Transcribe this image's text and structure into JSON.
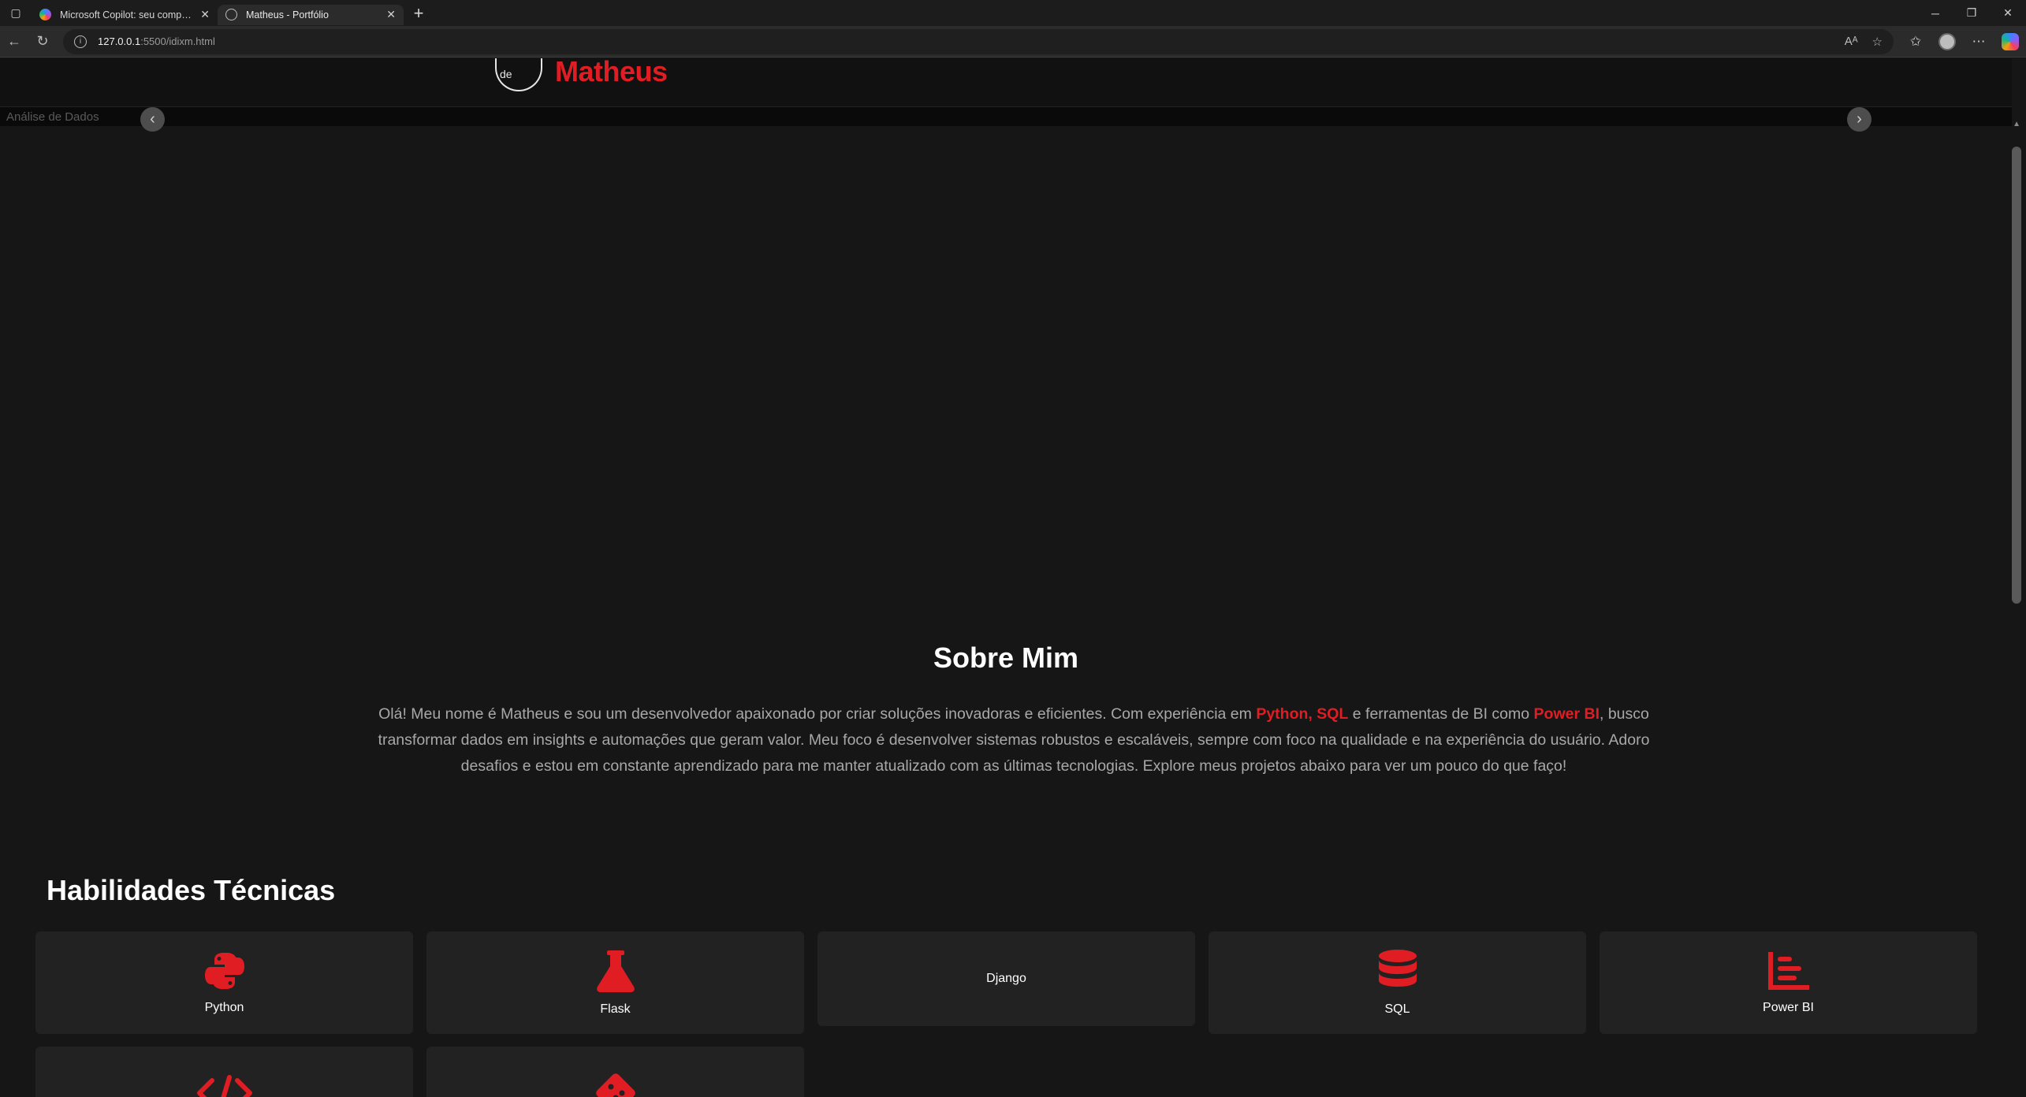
{
  "browser": {
    "tabs": [
      {
        "title": "Microsoft Copilot: seu companheiro",
        "active": false
      },
      {
        "title": "Matheus - Portfólio",
        "active": true
      }
    ],
    "url_host": "127.0.0.1",
    "url_path": ":5500/idixm.html"
  },
  "header": {
    "logo_text": "de",
    "brand": "Matheus"
  },
  "carousel": {
    "alt_text": "Análise de Dados"
  },
  "about": {
    "title": "Sobre Mim",
    "p1": "Olá! Meu nome é Matheus e sou um desenvolvedor apaixonado por criar soluções inovadoras e eficientes. Com experiência em ",
    "hl1": "Python",
    "sep1": ", ",
    "hl2": "SQL",
    "p2": " e ferramentas de BI como ",
    "hl3": "Power BI",
    "p3": ", busco transformar dados em insights e automações que geram valor. Meu foco é desenvolver sistemas robustos e escaláveis, sempre com foco na qualidade e na experiência do usuário. Adoro desafios e estou em constante aprendizado para me manter atualizado com as últimas tecnologias. Explore meus projetos abaixo para ver um pouco do que faço!"
  },
  "skills": {
    "title": "Habilidades Técnicas",
    "items": [
      {
        "label": "Python",
        "icon": "python-icon"
      },
      {
        "label": "Flask",
        "icon": "flask-icon"
      },
      {
        "label": "Django",
        "icon": ""
      },
      {
        "label": "SQL",
        "icon": "database-icon"
      },
      {
        "label": "Power BI",
        "icon": "bar-chart-icon"
      },
      {
        "label": "",
        "icon": "code-icon"
      },
      {
        "label": "",
        "icon": "git-icon"
      }
    ]
  },
  "colors": {
    "accent": "#e11d24",
    "background": "#161616",
    "card": "#222222"
  }
}
